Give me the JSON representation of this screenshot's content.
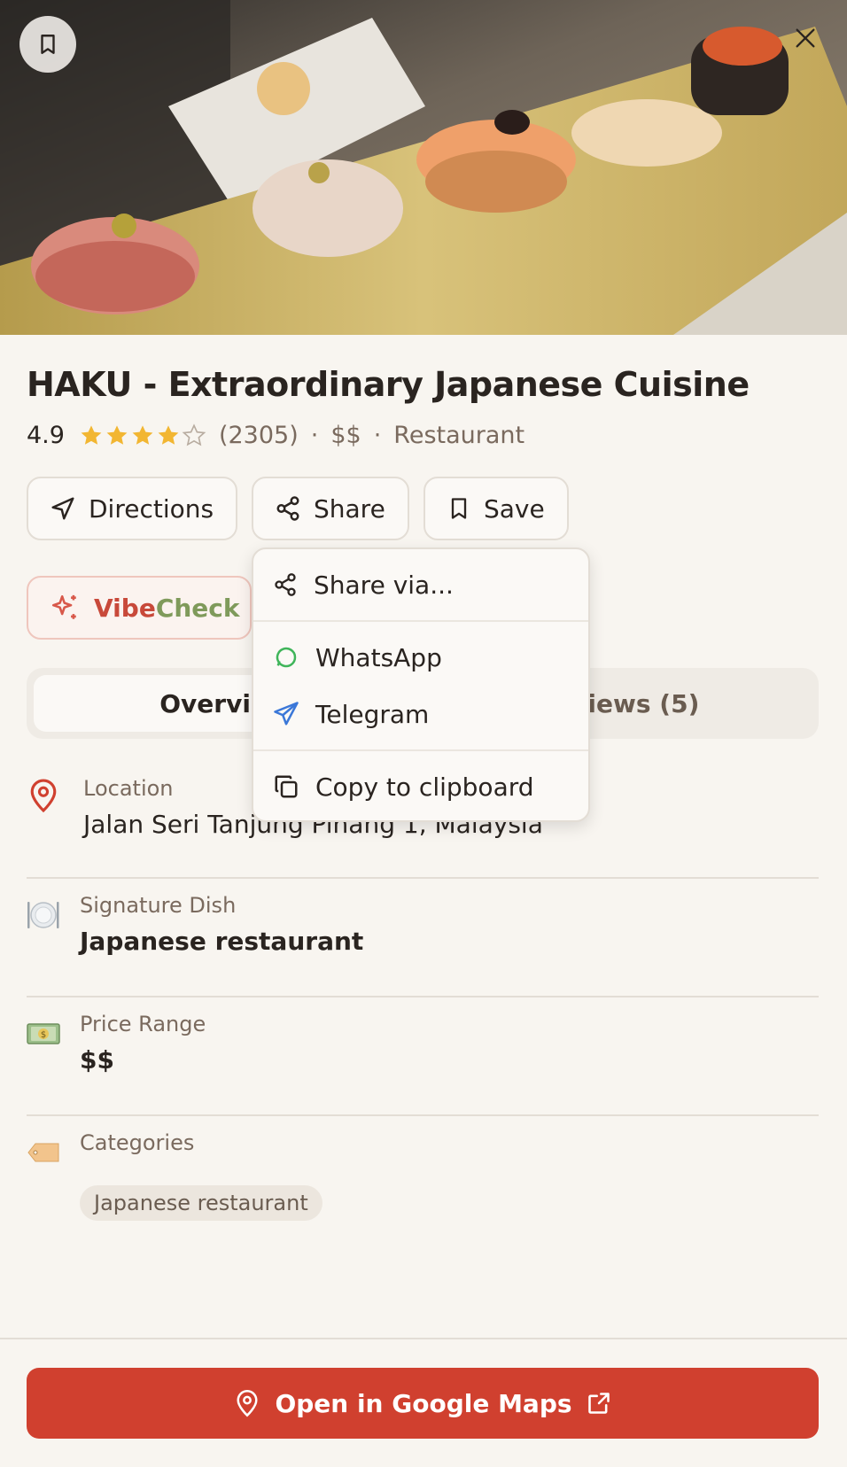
{
  "place": {
    "name": "HAKU - Extraordinary Japanese Cuisine",
    "rating": "4.9",
    "stars": 4.5,
    "review_count": "(2305)",
    "price": "$$",
    "type": "Restaurant",
    "separator": "·"
  },
  "actions": {
    "directions": "Directions",
    "share": "Share",
    "save": "Save"
  },
  "vibecheck": {
    "part1": "Vibe",
    "part2": "Check"
  },
  "tabs": {
    "overview": "Overview",
    "reviews": "Reviews (5)"
  },
  "details": {
    "location": {
      "label": "Location",
      "value": "Jalan Seri Tanjung Pinang 1, Malaysia"
    },
    "signature": {
      "label": "Signature Dish",
      "value": "Japanese restaurant"
    },
    "price": {
      "label": "Price Range",
      "value": "$$"
    },
    "categories": {
      "label": "Categories",
      "items": [
        "Japanese restaurant"
      ]
    }
  },
  "share_menu": {
    "share_via": "Share via...",
    "whatsapp": "WhatsApp",
    "telegram": "Telegram",
    "copy": "Copy to clipboard"
  },
  "footer": {
    "open_maps": "Open in Google Maps"
  },
  "colors": {
    "accent_red": "#d0402f",
    "star": "#f2b632",
    "whatsapp": "#3fb55a",
    "telegram": "#3b78d8"
  },
  "icons": [
    "bookmark-icon",
    "close-icon",
    "star-icon",
    "navigation-icon",
    "share-icon",
    "sparkles-icon",
    "map-pin-icon",
    "plate-icon",
    "money-icon",
    "tag-icon",
    "whatsapp-icon",
    "telegram-icon",
    "copy-icon",
    "external-link-icon"
  ]
}
